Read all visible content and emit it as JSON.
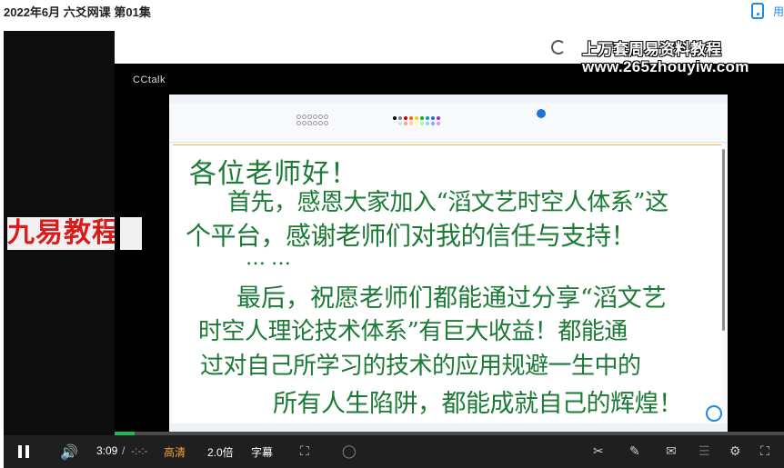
{
  "header": {
    "title": "2022年6月 六爻网课 第01集",
    "right_text": "用"
  },
  "video": {
    "left_overlay": "九易教程",
    "cctalk": "CCtalk",
    "watermark_line1": "上万套周易资料教程",
    "watermark_line2": "www.265zhouyiw.com",
    "window_min": "□",
    "window_close": "×"
  },
  "whiteboard": {
    "lines": [
      "各位老师好！",
      "首先，感恩大家加入“滔文艺时空人体系”这",
      "个平台，感谢老师们对我的信任与支持！",
      "……",
      "最后，祝愿老师们都能通过分享“滔文艺",
      "时空人理论技术体系”有巨大收益！都能通",
      "过对自己所学习的技术的应用规避一生中的",
      "所有人生陷阱，都能成就自己的辉煌！"
    ]
  },
  "player": {
    "time_current": "3:09",
    "time_sep": "/",
    "time_total": "-:-:-",
    "quality": "高清",
    "speed": "2.0倍",
    "subtitle": "字幕",
    "progress_fraction": 0.03
  },
  "colors": {
    "handwriting": "#1b7a35",
    "progress": "#1db954",
    "quality_accent": "#f2a33a"
  }
}
